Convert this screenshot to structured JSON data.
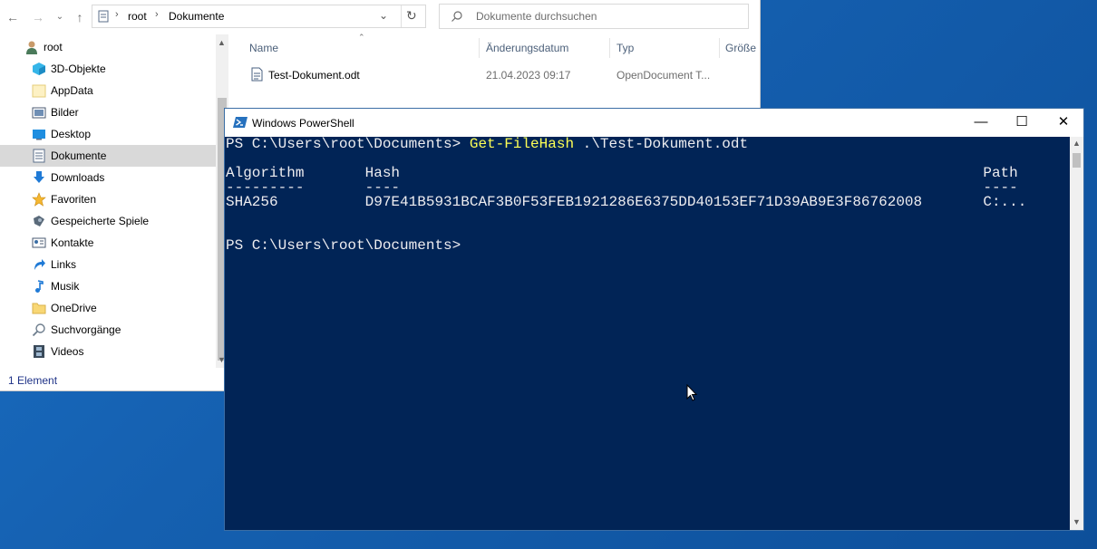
{
  "colors": {
    "desktop": "#1560b0",
    "powershell_bg": "#012456",
    "powershell_text": "#eeedf0",
    "powershell_cmd": "#ffff55",
    "selection": "#d9d9d9"
  },
  "explorer": {
    "address": {
      "crumbs": [
        "root",
        "Dokumente"
      ]
    },
    "search": {
      "placeholder": "Dokumente durchsuchen"
    },
    "nav": {
      "root": "root",
      "items": [
        "3D-Objekte",
        "AppData",
        "Bilder",
        "Desktop",
        "Dokumente",
        "Downloads",
        "Favoriten",
        "Gespeicherte Spiele",
        "Kontakte",
        "Links",
        "Musik",
        "OneDrive",
        "Suchvorgänge",
        "Videos"
      ],
      "selected": "Dokumente"
    },
    "columns": {
      "name": "Name",
      "date": "Änderungsdatum",
      "type": "Typ",
      "size": "Größe"
    },
    "files": [
      {
        "name": "Test-Dokument.odt",
        "date": "21.04.2023 09:17",
        "type": "OpenDocument T..."
      }
    ],
    "status": "1 Element"
  },
  "powershell": {
    "title": "Windows PowerShell",
    "lines": {
      "prompt1": "PS C:\\Users\\root\\Documents> ",
      "cmd1": "Get-FileHash",
      "arg1": " .\\Test-Dokument.odt",
      "header": "Algorithm       Hash                                                                   Path",
      "underline": "---------       ----                                                                   ----",
      "row": "SHA256          D97E41B5931BCAF3B0F53FEB1921286E6375DD40153EF71D39AB9E3F86762008       C:...",
      "prompt2": "PS C:\\Users\\root\\Documents>"
    }
  }
}
